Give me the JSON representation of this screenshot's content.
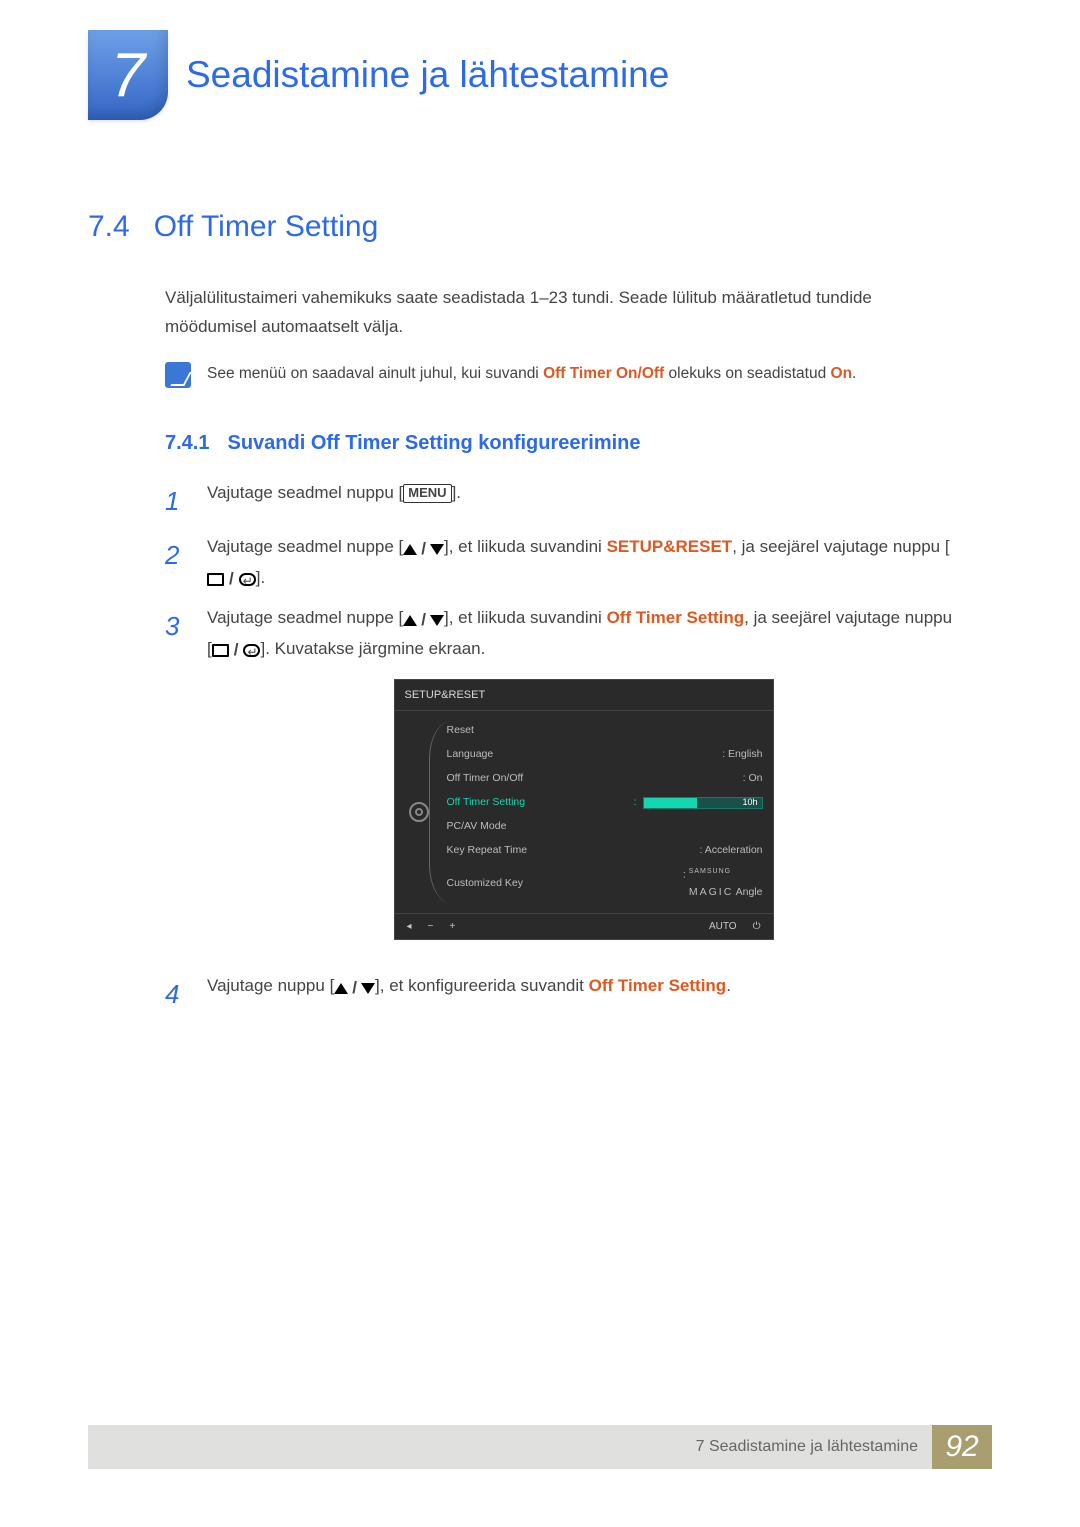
{
  "chapter": {
    "number": "7",
    "title": "Seadistamine ja lähtestamine"
  },
  "section": {
    "number": "7.4",
    "title": "Off Timer Setting",
    "intro": "Väljalülitustaimeri vahemikuks saate seadistada 1–23 tundi. Seade lülitub määratletud tundide möödumisel automaatselt välja."
  },
  "note": {
    "pre": "See menüü on saadaval ainult juhul, kui suvandi ",
    "hl1": "Off Timer On/Off",
    "mid": " olekuks on seadistatud ",
    "hl2": "On",
    "post": "."
  },
  "subsection": {
    "number": "7.4.1",
    "title": "Suvandi Off Timer Setting konfigureerimine"
  },
  "steps": {
    "s1": {
      "num": "1",
      "pre": "Vajutage seadmel nuppu [",
      "key": "MENU",
      "post": "]."
    },
    "s2": {
      "num": "2",
      "pre": "Vajutage seadmel nuppe [",
      "mid": "], et liikuda suvandini ",
      "hl": "SETUP&RESET",
      "post2": ", ja seejärel vajutage nuppu [",
      "post3": "]."
    },
    "s3": {
      "num": "3",
      "pre": "Vajutage seadmel nuppe [",
      "mid": "], et liikuda suvandini ",
      "hl": "Off Timer Setting",
      "post2": ", ja seejärel vajutage nuppu [",
      "post3": "]. Kuvatakse järgmine ekraan."
    },
    "s4": {
      "num": "4",
      "pre": "Vajutage nuppu [",
      "mid": "], et konfigureerida suvandit ",
      "hl": "Off Timer Setting",
      "post": "."
    }
  },
  "osd": {
    "title": "SETUP&RESET",
    "rows": {
      "reset": "Reset",
      "language": "Language",
      "language_val": "English",
      "offtimer_onoff": "Off Timer On/Off",
      "offtimer_onoff_val": "On",
      "offtimer_setting": "Off Timer Setting",
      "offtimer_setting_val": "10h",
      "pcav": "PC/AV Mode",
      "keyrepeat": "Key Repeat Time",
      "keyrepeat_val": "Acceleration",
      "custkey": "Customized Key",
      "custkey_val_brand_sup": "SAMSUNG",
      "custkey_val_brand": "MAGIC",
      "custkey_val_tail": " Angle"
    },
    "footer": {
      "left1": "◂",
      "left2": "−",
      "left3": "+",
      "auto": "AUTO",
      "power": "⏻"
    }
  },
  "footer": {
    "text": "7 Seadistamine ja lähtestamine",
    "page": "92"
  }
}
